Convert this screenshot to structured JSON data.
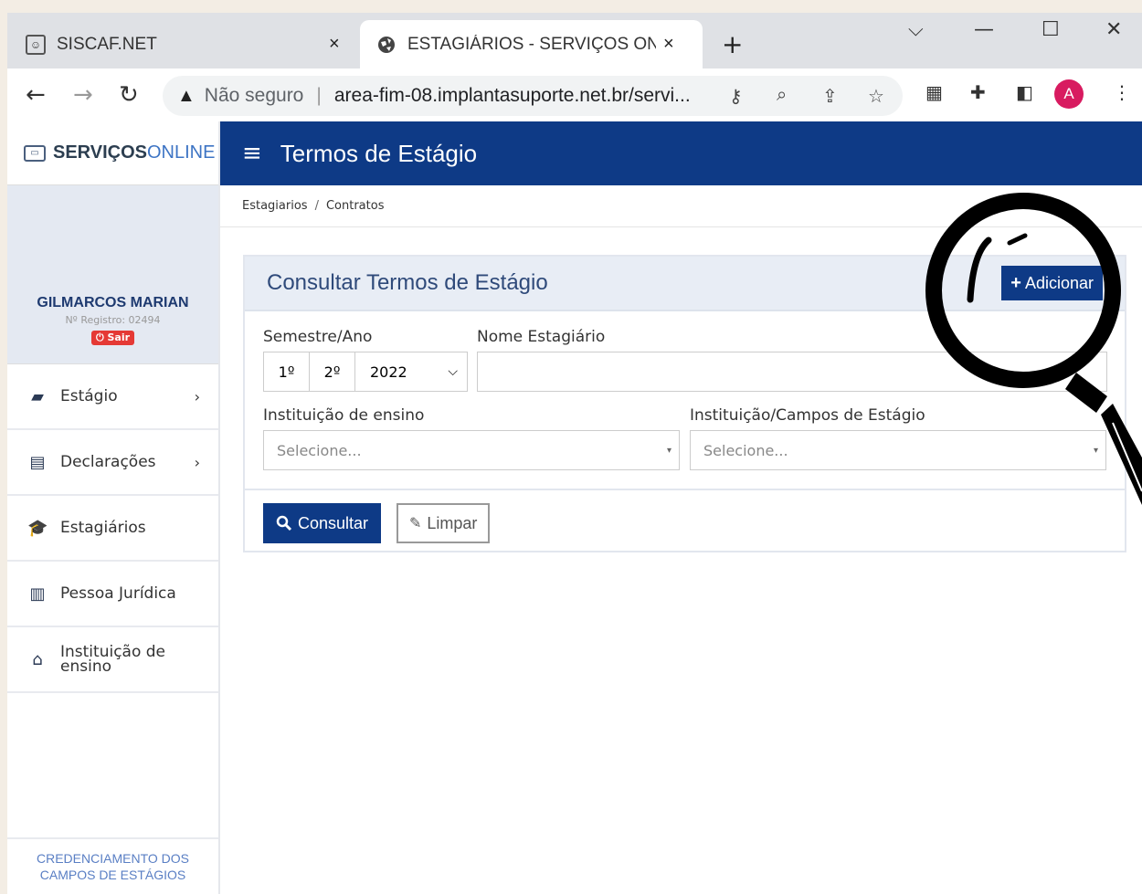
{
  "browser": {
    "tabs": [
      {
        "title": "SISCAF.NET",
        "close": "×"
      },
      {
        "title": "ESTAGIÁRIOS - SERVIÇOS ONLINE",
        "close": "×"
      }
    ],
    "new_tab": "+",
    "security_warning": "Não seguro",
    "url": "area-fim-08.implantasuporte.net.br/servi...",
    "profile_initial": "A"
  },
  "brand": {
    "part1": "SERVIÇOS",
    "part2": "ONLINE"
  },
  "user": {
    "name": "GILMARCOS MARIAN",
    "registry": "Nº Registro: 02494",
    "logout": "Sair"
  },
  "sidebar": {
    "items": [
      {
        "label": "Estágio",
        "icon": "folder-open-icon",
        "has_chevron": true
      },
      {
        "label": "Declarações",
        "icon": "file-icon",
        "has_chevron": true
      },
      {
        "label": "Estagiários",
        "icon": "graduation-cap-icon",
        "has_chevron": false
      },
      {
        "label": "Pessoa Jurídica",
        "icon": "building-icon",
        "has_chevron": false
      },
      {
        "label": "Instituição de ensino",
        "icon": "institution-icon",
        "has_chevron": false
      }
    ],
    "footer": "CREDENCIAMENTO DOS CAMPOS DE ESTÁGIOS"
  },
  "header": {
    "title": "Termos de Estágio"
  },
  "breadcrumb": {
    "items": [
      "Estagiarios",
      "Contratos"
    ],
    "separator": "/"
  },
  "panel": {
    "title": "Consultar Termos de Estágio",
    "add_label": "Adicionar",
    "semester_label": "Semestre/Ano",
    "semester_options": [
      "1º",
      "2º"
    ],
    "year_value": "2022",
    "name_label": "Nome Estagiário",
    "name_value": "",
    "institution_label": "Instituição de ensino",
    "institution_placeholder": "Selecione...",
    "campus_label": "Instituição/Campos de Estágio",
    "campus_placeholder": "Selecione...",
    "search_label": "Consultar",
    "clear_label": "Limpar"
  },
  "colors": {
    "primary": "#0e3a86",
    "panel_head": "#e8edf5",
    "accent": "#3d74c4",
    "danger": "#e53935"
  }
}
